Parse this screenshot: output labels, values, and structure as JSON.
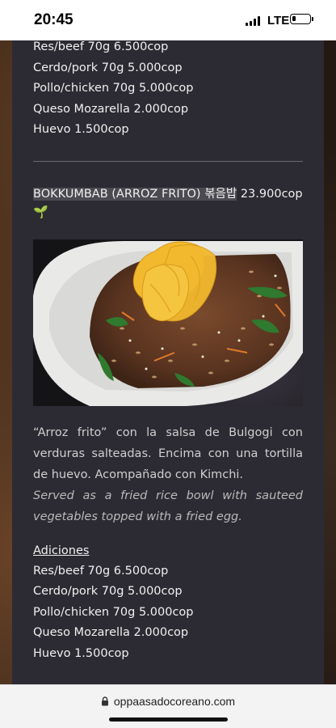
{
  "status_bar": {
    "time": "20:45",
    "network": "LTE",
    "battery_level": 0.2
  },
  "top_additions": [
    "Res/beef 70g 6.500cop",
    "Cerdo/pork 70g 5.000cop",
    "Pollo/chicken 70g 5.000cop",
    "Queso Mozarella 2.000cop",
    "Huevo 1.500cop"
  ],
  "dish": {
    "title": "BOKKUMBAB (ARROZ FRITO) 볶음밥",
    "price": "23.900cop",
    "badge_icon": "sprout-icon",
    "badge_glyph": "🌱",
    "image_icon": "fried-rice-bowl-photo",
    "description_es": "“Arroz frito” con la salsa de Bulgogi con verduras salteadas. Encima con una tortilla de huevo. Acompañado con Kimchi.",
    "description_en": "Served as a fried rice bowl with sauteed vegetables topped with a fried egg.",
    "additions_heading": "Adiciones",
    "additions": [
      "Res/beef 70g 6.500cop",
      "Cerdo/pork 70g 5.000cop",
      "Pollo/chicken 70g 5.000cop",
      "Queso Mozarella 2.000cop",
      "Huevo 1.500cop"
    ]
  },
  "browser": {
    "url": "oppaasadocoreano.com"
  },
  "colors": {
    "panel": "#2c2b34",
    "text": "#f0f0f0",
    "sprout": "#74c043",
    "egg": "#f2b92e"
  }
}
